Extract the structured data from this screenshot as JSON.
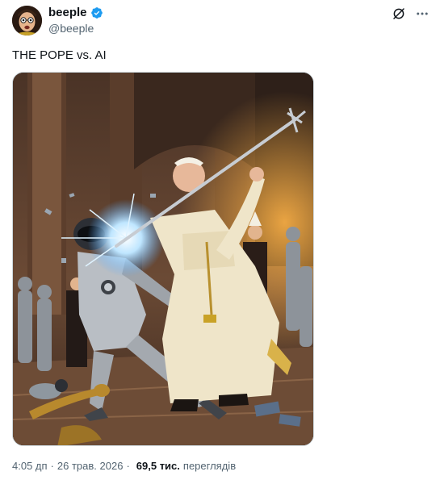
{
  "author": {
    "display_name": "beeple",
    "handle": "@beeple",
    "verified": true,
    "avatar_icon": "avatar-face-icon"
  },
  "header_actions": {
    "grok_icon": "grok-icon",
    "more_icon": "more-horizontal-icon"
  },
  "tweet": {
    "text": "THE POPE vs. AI",
    "media_description_icon": "pope-vs-robot-artwork"
  },
  "meta": {
    "time": "4:05 дп",
    "separator": "·",
    "date": "26 трав. 2026",
    "views_count": "69,5 тис.",
    "views_label": "переглядів"
  },
  "colors": {
    "text_primary": "#0f1419",
    "text_secondary": "#536471",
    "verified_blue": "#1d9bf0",
    "border": "#cfd9de"
  }
}
